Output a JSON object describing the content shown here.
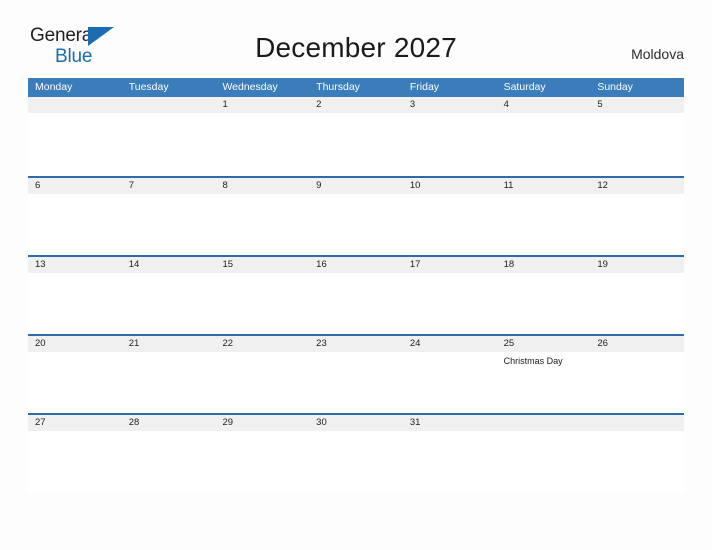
{
  "brand": {
    "name_part1": "General",
    "name_part2": "Blue",
    "triangle_icon": "triangle-icon",
    "accent_color": "#1b6cb0"
  },
  "header": {
    "title": "December 2027",
    "country": "Moldova"
  },
  "theme": {
    "header_blue": "#3b7cba",
    "rule_blue": "#2c6ca8",
    "date_band_gray": "#f0f0f0",
    "page_background": "#fdfdfd"
  },
  "calendar": {
    "month": "December",
    "year": "2027",
    "weekday_headers": [
      "Monday",
      "Tuesday",
      "Wednesday",
      "Thursday",
      "Friday",
      "Saturday",
      "Sunday"
    ],
    "weeks": [
      {
        "days": [
          {
            "date": "",
            "events": []
          },
          {
            "date": "",
            "events": []
          },
          {
            "date": "1",
            "events": []
          },
          {
            "date": "2",
            "events": []
          },
          {
            "date": "3",
            "events": []
          },
          {
            "date": "4",
            "events": []
          },
          {
            "date": "5",
            "events": []
          }
        ]
      },
      {
        "days": [
          {
            "date": "6",
            "events": []
          },
          {
            "date": "7",
            "events": []
          },
          {
            "date": "8",
            "events": []
          },
          {
            "date": "9",
            "events": []
          },
          {
            "date": "10",
            "events": []
          },
          {
            "date": "11",
            "events": []
          },
          {
            "date": "12",
            "events": []
          }
        ]
      },
      {
        "days": [
          {
            "date": "13",
            "events": []
          },
          {
            "date": "14",
            "events": []
          },
          {
            "date": "15",
            "events": []
          },
          {
            "date": "16",
            "events": []
          },
          {
            "date": "17",
            "events": []
          },
          {
            "date": "18",
            "events": []
          },
          {
            "date": "19",
            "events": []
          }
        ]
      },
      {
        "days": [
          {
            "date": "20",
            "events": []
          },
          {
            "date": "21",
            "events": []
          },
          {
            "date": "22",
            "events": []
          },
          {
            "date": "23",
            "events": []
          },
          {
            "date": "24",
            "events": []
          },
          {
            "date": "25",
            "events": [
              "Christmas Day"
            ]
          },
          {
            "date": "26",
            "events": []
          }
        ]
      },
      {
        "days": [
          {
            "date": "27",
            "events": []
          },
          {
            "date": "28",
            "events": []
          },
          {
            "date": "29",
            "events": []
          },
          {
            "date": "30",
            "events": []
          },
          {
            "date": "31",
            "events": []
          },
          {
            "date": "",
            "events": []
          },
          {
            "date": "",
            "events": []
          }
        ]
      }
    ]
  }
}
